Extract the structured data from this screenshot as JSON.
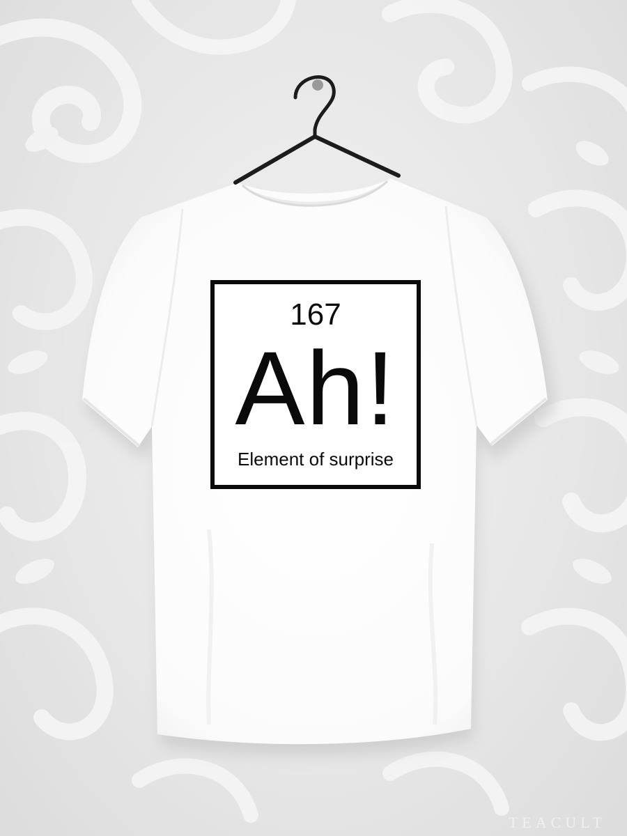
{
  "photo": {
    "background_color": "#e8e8e8",
    "pattern_color": "#f4f4f4",
    "shirt_color": "#ffffff",
    "hanger_color": "#1c1c1c",
    "hook_color": "#9a9a9a"
  },
  "print": {
    "number": "167",
    "symbol": "Ah!",
    "name": "Element of surprise",
    "ink_color": "#0a0a0a"
  },
  "watermark": {
    "text": "TEACULT"
  }
}
